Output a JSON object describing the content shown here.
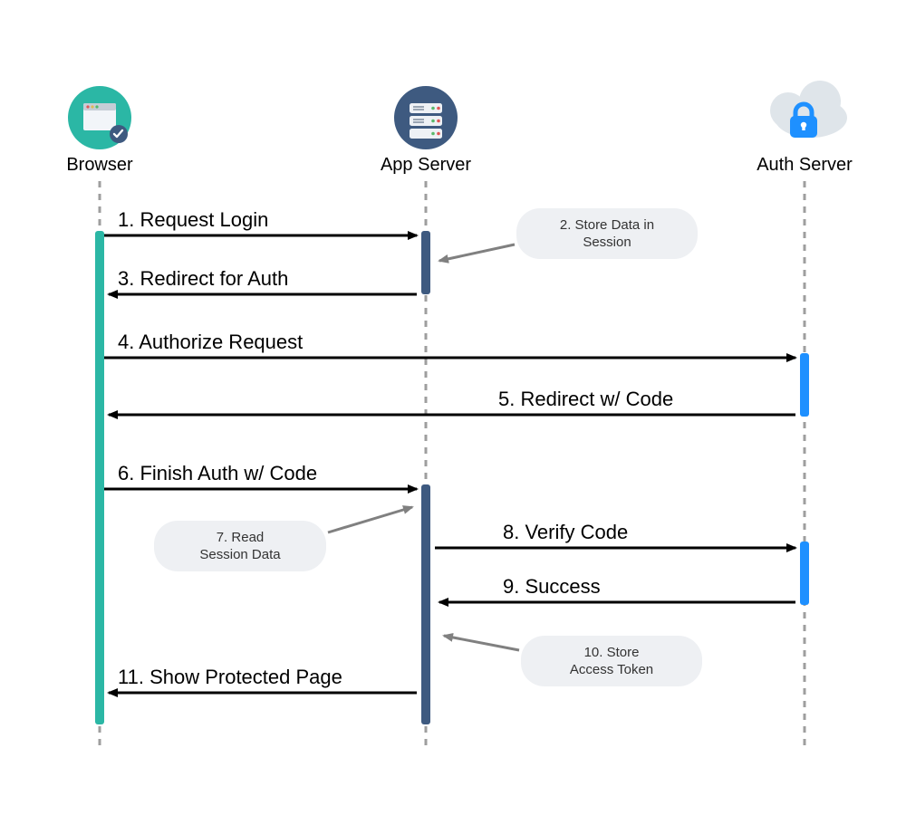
{
  "actors": {
    "browser": {
      "label": "Browser"
    },
    "app": {
      "label": "App Server"
    },
    "auth": {
      "label": "Auth Server"
    }
  },
  "messages": {
    "m1": "1. Request Login",
    "m3": "3. Redirect for Auth",
    "m4": "4. Authorize Request",
    "m5": "5. Redirect w/ Code",
    "m6": "6. Finish Auth w/ Code",
    "m8": "8. Verify Code",
    "m9": "9. Success",
    "m11": "11. Show Protected Page"
  },
  "notes": {
    "n2a": "2. Store Data in",
    "n2b": "Session",
    "n7a": "7. Read",
    "n7b": "Session Data",
    "n10a": "10. Store",
    "n10b": "Access Token"
  },
  "colors": {
    "browser": "#2bb7a5",
    "appDark": "#3e5a80",
    "authBlue": "#1e90ff",
    "lifeline": "#9e9e9e",
    "arrow": "#000000",
    "noteArrow": "#808080",
    "bubbleBg": "#eef0f3",
    "bubbleBg2": "#e7eaef",
    "cloud": "#dfe5ea"
  }
}
